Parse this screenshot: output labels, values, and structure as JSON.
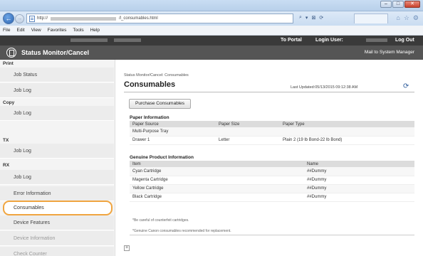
{
  "browser": {
    "url_prefix": "http://",
    "url_suffix": "/l_consumables.html",
    "window_buttons": [
      "–",
      "□",
      "✕"
    ],
    "addr_tools": [
      "⌕",
      "▾",
      "⊠",
      "⟳"
    ],
    "right_icons": [
      "⌂",
      "☆",
      "⚙"
    ],
    "menu": [
      "File",
      "Edit",
      "View",
      "Favorites",
      "Tools",
      "Help"
    ]
  },
  "header": {
    "to_portal": "To Portal",
    "login_user_label": "Login User:",
    "log_out": "Log Out",
    "title": "Status Monitor/Cancel",
    "mail_link": "Mail to System Manager"
  },
  "sidebar": {
    "print_label": "Print",
    "copy_label": "Copy",
    "tx_label": "TX",
    "rx_label": "RX",
    "items": [
      "Job Status",
      "Job Log",
      "Job Log",
      "Job Log",
      "Job Log",
      "Error Information",
      "Consumables",
      "Device Features",
      "Device Information",
      "Check Counter"
    ]
  },
  "main": {
    "breadcrumb": "Status Monitor/Cancel: Consumables",
    "title": "Consumables",
    "last_updated": "Last Updated:05/13/2015 09:12:38 AM",
    "purchase_button": "Purchase Consumables",
    "paper_section": "Paper Information",
    "paper_headers": [
      "Paper Source",
      "Paper Size",
      "Paper Type"
    ],
    "paper_rows": [
      [
        "Multi-Purpose Tray",
        "",
        ""
      ],
      [
        "Drawer 1",
        "Letter",
        "Plain 2 (19 lb Bond-22 lb Bond)"
      ]
    ],
    "genuine_section": "Genuine Product Information",
    "genuine_headers": [
      "Item",
      "Name"
    ],
    "genuine_rows": [
      [
        "Cyan Cartridge",
        "##Dummy"
      ],
      [
        "Magenta Cartridge",
        "##Dummy"
      ],
      [
        "Yellow Cartridge",
        "##Dummy"
      ],
      [
        "Black Cartridge",
        "##Dummy"
      ]
    ],
    "note1": "*Be careful of counterfeit cartridges.",
    "note2": "*Genuine Canon consumables recommended for replacement.",
    "expand": "+"
  }
}
